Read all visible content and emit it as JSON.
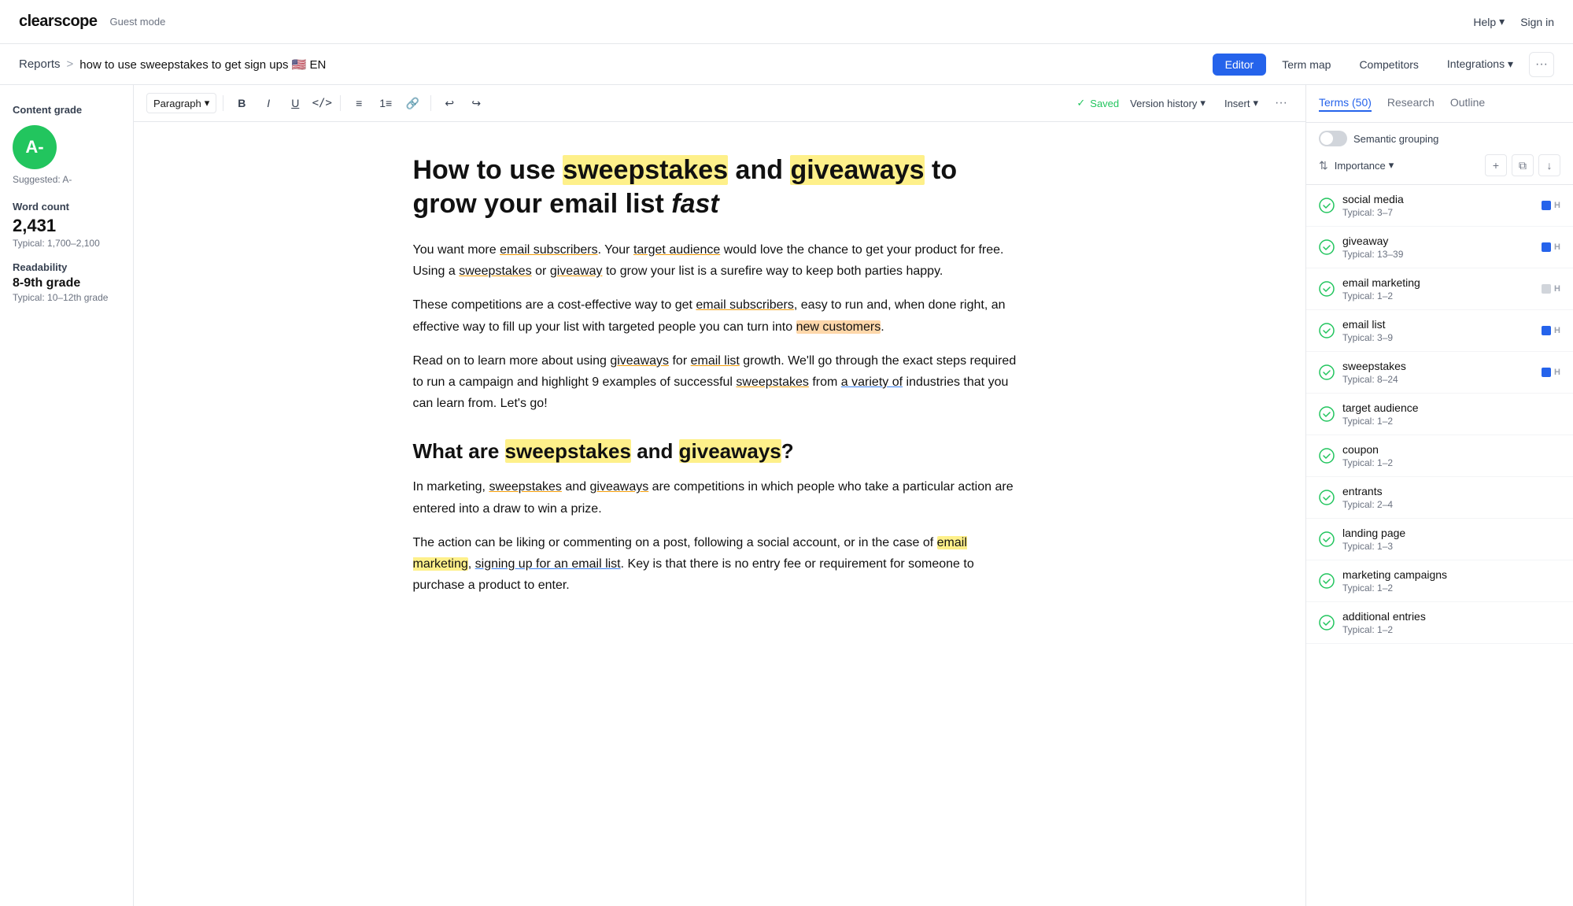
{
  "app": {
    "logo": "clearscope",
    "guest_mode": "Guest mode",
    "nav_help": "Help",
    "nav_signin": "Sign in"
  },
  "breadcrumb": {
    "reports": "Reports",
    "separator": ">",
    "current_title": "how to use sweepstakes to get sign ups",
    "flag": "🇺🇸",
    "lang": "EN"
  },
  "tabs": {
    "editor": "Editor",
    "term_map": "Term map",
    "competitors": "Competitors",
    "integrations": "Integrations"
  },
  "toolbar": {
    "paragraph": "Paragraph",
    "saved": "Saved",
    "version_history": "Version history",
    "insert": "Insert"
  },
  "left_sidebar": {
    "content_grade_label": "Content grade",
    "grade": "A-",
    "suggested_label": "Suggested: A-",
    "word_count_label": "Word count",
    "word_count": "2,431",
    "word_count_typical": "Typical: 1,700–2,100",
    "readability_label": "Readability",
    "readability_value": "8-9th grade",
    "readability_typical": "Typical: 10–12th grade"
  },
  "editor": {
    "title_part1": "How to use ",
    "title_highlight1": "sweepstakes",
    "title_part2": " and ",
    "title_highlight2": "giveaways",
    "title_part3": " to grow your email list ",
    "title_italic": "fast",
    "p1": "You want more email subscribers. Your target audience would love the chance to get your product for free. Using a sweepstakes or giveaway to grow your list is a surefire way to keep both parties happy.",
    "p2": "These competitions are a cost-effective way to get email subscribers, easy to run and, when done right, an effective way to fill up your list with targeted people you can turn into new customers.",
    "p3": "Read on to learn more about using giveaways for email list growth. We'll go through the exact steps required to run a campaign and highlight 9 examples of successful sweepstakes from a variety of industries that you can learn from. Let's go!",
    "h2": "What are sweepstakes and giveaways?",
    "p4": "In marketing, sweepstakes and giveaways are competitions in which people who take a particular action are entered into a draw to win a prize.",
    "p5": "The action can be liking or commenting on a post, following a social account, or in the case of email marketing, signing up for an email list. Key is that there is no entry fee or requirement for someone to purchase a product to enter."
  },
  "right_panel": {
    "tabs": {
      "terms": "Terms (50)",
      "research": "Research",
      "outline": "Outline"
    },
    "semantic_grouping": "Semantic grouping",
    "sort_label": "Importance",
    "terms": [
      {
        "name": "social media",
        "typical": "Typical: 3–7",
        "badge": "blue",
        "badge_label": "H"
      },
      {
        "name": "giveaway",
        "typical": "Typical: 13–39",
        "badge": "blue",
        "badge_label": "H"
      },
      {
        "name": "email marketing",
        "typical": "Typical: 1–2",
        "badge": "gray",
        "badge_label": "H"
      },
      {
        "name": "email list",
        "typical": "Typical: 3–9",
        "badge": "blue",
        "badge_label": "H"
      },
      {
        "name": "sweepstakes",
        "typical": "Typical: 8–24",
        "badge": "blue",
        "badge_label": "H"
      },
      {
        "name": "target audience",
        "typical": "Typical: 1–2",
        "badge": null,
        "badge_label": ""
      },
      {
        "name": "coupon",
        "typical": "Typical: 1–2",
        "badge": null,
        "badge_label": ""
      },
      {
        "name": "entrants",
        "typical": "Typical: 2–4",
        "badge": null,
        "badge_label": ""
      },
      {
        "name": "landing page",
        "typical": "Typical: 1–3",
        "badge": null,
        "badge_label": ""
      },
      {
        "name": "marketing campaigns",
        "typical": "Typical: 1–2",
        "badge": null,
        "badge_label": ""
      },
      {
        "name": "additional entries",
        "typical": "Typical: 1–2",
        "badge": null,
        "badge_label": ""
      }
    ]
  }
}
